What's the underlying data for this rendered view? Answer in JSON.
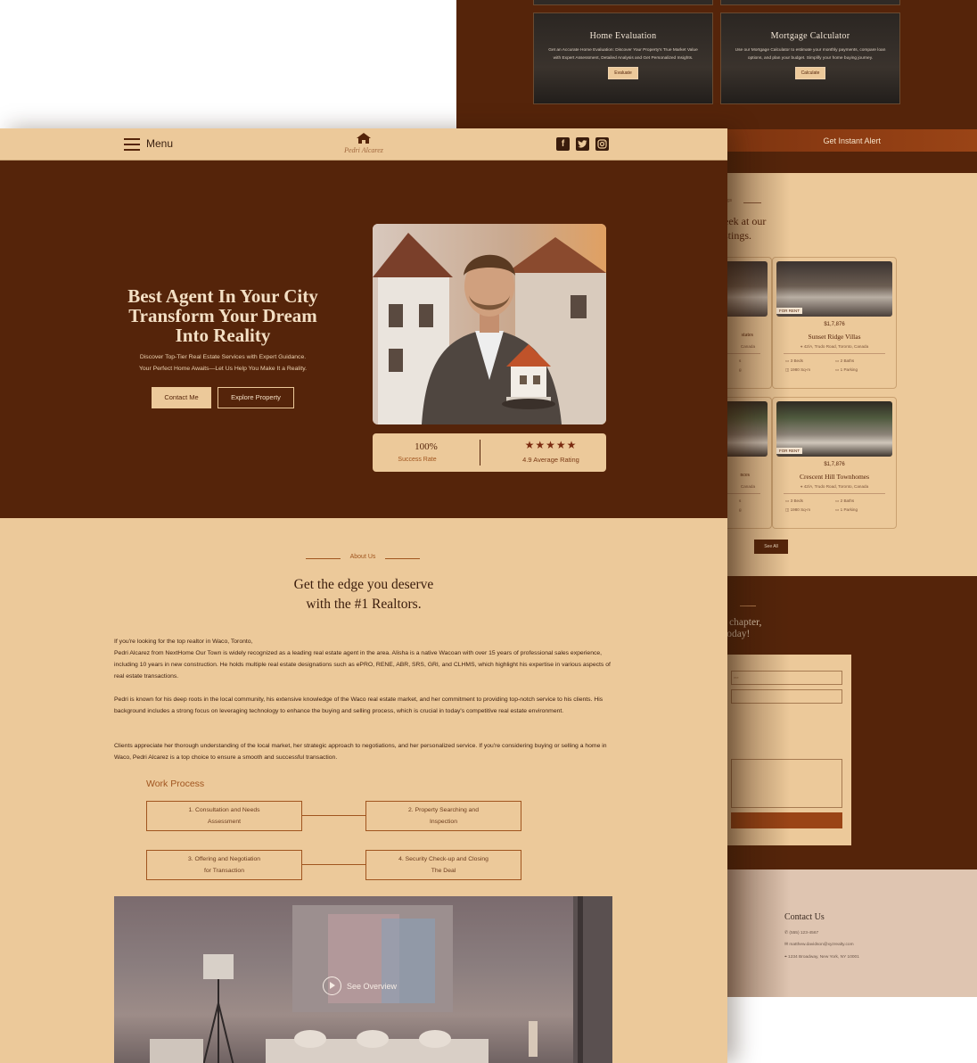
{
  "back": {
    "tools": [
      {
        "title": "Home Evaluation",
        "desc": "Get an Accurate Home Evaluation: Discover Your Property's True Market Value with Expert Assessment, Detailed Analysis and Get Personalized Insights.",
        "button": "Evaluate"
      },
      {
        "title": "Mortgage Calculator",
        "desc": "Use our Mortgage Calculator to estimate your monthly payments, compare loan options, and plan your budget. Simplify your home buying journey.",
        "button": "Calculate"
      }
    ],
    "alert_label": "Get Instant Alert",
    "listings": {
      "eyebrow_fragment": "ings",
      "heading_line1": "eek at our",
      "heading_line2": "stings.",
      "partial_cards": [
        {
          "name_fragment": "states",
          "addr_fragment": "Canada",
          "f1": "s",
          "f2": "g"
        },
        {
          "name_fragment": "nces",
          "addr_fragment": "Canada",
          "f1": "s",
          "f2": "g"
        }
      ],
      "cards": [
        {
          "tag": "FOR RENT",
          "price": "$1,7,876",
          "name": "Sunset Ridge Villas",
          "address": "42/A, Trudo Road, Toronto, Canada",
          "beds": "3 Beds",
          "baths": "2 Baths",
          "area": "1980 Sq-m",
          "parking": "1 Parking"
        },
        {
          "tag": "FOR RENT",
          "price": "$1,7,876",
          "name": "Crescent Hill Townhomes",
          "address": "42/A, Trudo Road, Toronto, Canada",
          "beds": "3 Beds",
          "baths": "2 Baths",
          "area": "1980 Sq-m",
          "parking": "1 Parking"
        }
      ],
      "see_all": "See All"
    },
    "cta": {
      "line1": "t chapter,",
      "line2": "today!",
      "name_placeholder": "me"
    },
    "contact_info": {
      "title": "Contact Us",
      "phone": "(555) 123-4567",
      "email": "matthew.davidson@xyzrealty.com",
      "address": "1234 Broadway, New York, NY 10001"
    }
  },
  "nav": {
    "menu_label": "Menu",
    "logo_text": "Pedri Alcarez",
    "social": [
      "facebook-icon",
      "twitter-icon",
      "instagram-icon"
    ]
  },
  "hero": {
    "title_lines": [
      "Best Agent In Your City",
      "Transform Your Dream",
      "Into Reality"
    ],
    "subtitle_lines": [
      "Discover Top-Tier Real Estate Services with Expert Guidance.",
      "Your Perfect Home Awaits—Let Us Help You Make It a Reality."
    ],
    "btn_contact": "Contact Me",
    "btn_explore": "Explore Property",
    "stat_success_value": "100%",
    "stat_success_label": "Success Rate",
    "stars": "★★★★★",
    "rating_value": 4.9,
    "rating_label": "4.9 Average Rating"
  },
  "about": {
    "eyebrow": "About Us",
    "heading_lines": [
      "Get the edge you deserve",
      "with the #1 Realtors."
    ],
    "paragraphs": [
      "If you're looking for the top realtor in Waco, Toronto,",
      "Pedri Alcarez from NextHome Our Town is widely recognized as a leading real estate agent in the area. Alisha is a native Wacoan with over 15 years of professional sales experience, including 10 years in new construction. He holds multiple real estate designations such as ePRO, RENE, ABR, SRS, GRI, and CLHMS, which highlight his expertise in various aspects of real estate transactions.",
      "Pedri is known for his deep roots in the local community, his extensive knowledge of the Waco real estate market, and her commitment to providing top-notch service to his clients. His background includes a strong focus on leveraging technology to enhance the buying and selling process, which is crucial in today's competitive real estate environment.",
      "Clients appreciate her thorough understanding of the local market, her strategic approach to negotiations, and her personalized service. If you're considering buying or selling a home in Waco, Pedri Alcarez is a top choice to ensure a smooth and successful transaction."
    ],
    "work_process_title": "Work Process",
    "steps": [
      {
        "line1": "1. Consultation and Needs",
        "line2": "Assessment"
      },
      {
        "line1": "2. Property Searching and",
        "line2": "Inspection"
      },
      {
        "line1": "3. Offering and Negotiation",
        "line2": "for Transaction"
      },
      {
        "line1": "4. Security Check-up and Closing",
        "line2": "The Deal"
      }
    ],
    "video_label": "See Overview"
  },
  "colors": {
    "brand_dark": "#55240a",
    "brand_light": "#ecc99a",
    "accent": "#9a4416"
  }
}
